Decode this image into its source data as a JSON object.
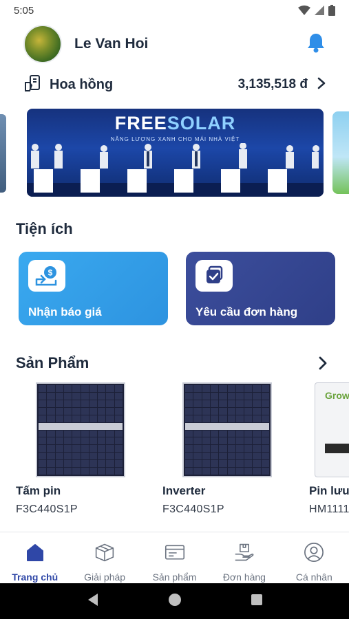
{
  "status_bar": {
    "time": "5:05"
  },
  "header": {
    "user_name": "Le Van Hoi"
  },
  "commission": {
    "label": "Hoa hồng",
    "value": "3,135,518 đ"
  },
  "banner": {
    "title_a": "FREE",
    "title_b": "SOLAR",
    "subtitle": "NĂNG LƯỢNG XANH CHO MÁI NHÀ VIỆT"
  },
  "utilities": {
    "title": "Tiện ích",
    "items": [
      {
        "label": "Nhận báo giá",
        "icon": "quote-dollar-icon"
      },
      {
        "label": "Yêu cầu đơn hàng",
        "icon": "order-request-icon"
      }
    ]
  },
  "products": {
    "title": "Sản Phẩm",
    "items": [
      {
        "name": "Tấm pin",
        "code": "F3C440S1P"
      },
      {
        "name": "Inverter",
        "code": "F3C440S1P"
      },
      {
        "name": "Pin lưu",
        "code": "HM1111",
        "brand": "Grow"
      }
    ]
  },
  "tabs": [
    {
      "label": "Trang chủ",
      "icon": "home-icon",
      "active": true
    },
    {
      "label": "Giải pháp",
      "icon": "box-icon"
    },
    {
      "label": "Sản phẩm",
      "icon": "card-icon"
    },
    {
      "label": "Đơn hàng",
      "icon": "hand-box-icon"
    },
    {
      "label": "Cá nhân",
      "icon": "user-icon"
    }
  ],
  "colors": {
    "primary": "#2f47a7",
    "accent_blue": "#2d93e0",
    "bell": "#2f8ee8"
  }
}
